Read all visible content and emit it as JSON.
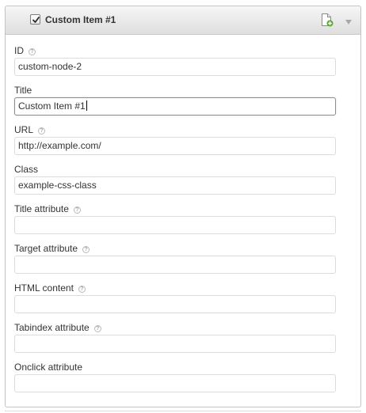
{
  "header": {
    "title": "Custom Item #1",
    "checked": true,
    "add_icon": "add-document-icon",
    "toggle_icon": "chevron-down-icon"
  },
  "fields": {
    "id": {
      "label": "ID",
      "value": "custom-node-2",
      "has_help": true
    },
    "title": {
      "label": "Title",
      "value": "Custom Item #1",
      "has_help": false
    },
    "url": {
      "label": "URL",
      "value": "http://example.com/",
      "has_help": true
    },
    "class": {
      "label": "Class",
      "value": "example-css-class",
      "has_help": false
    },
    "title_attribute": {
      "label": "Title attribute",
      "value": "",
      "has_help": true
    },
    "target_attribute": {
      "label": "Target attribute",
      "value": "",
      "has_help": true
    },
    "html_content": {
      "label": "HTML content",
      "value": "",
      "has_help": true
    },
    "tabindex_attribute": {
      "label": "Tabindex attribute",
      "value": "",
      "has_help": true
    },
    "onclick_attribute": {
      "label": "Onclick attribute",
      "value": "",
      "has_help": false
    }
  },
  "help_glyph": "?",
  "colors": {
    "header_top": "#f6f6f6",
    "header_bottom": "#dedede",
    "border": "#c4c4c4",
    "add_icon_accent": "#5aa832"
  }
}
